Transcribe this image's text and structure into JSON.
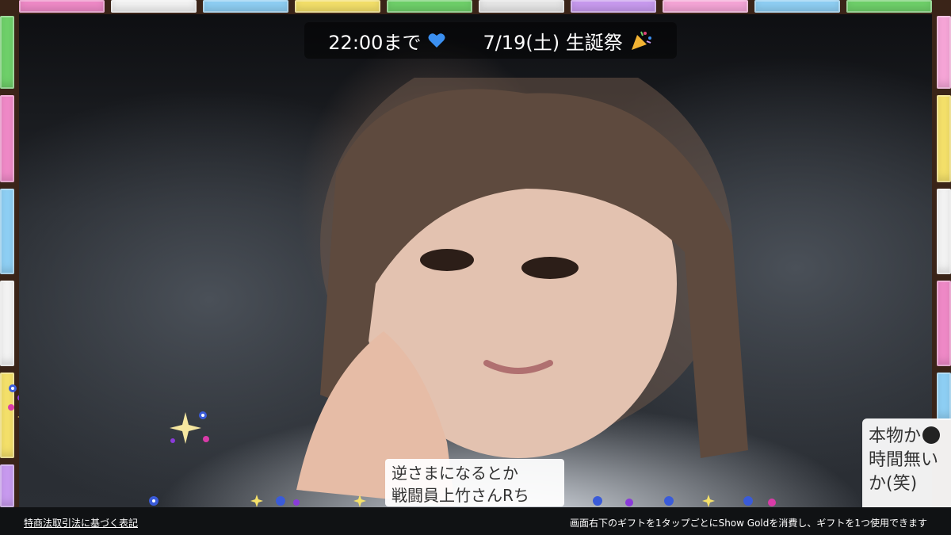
{
  "banner": {
    "time_text": "22:00まで",
    "date_text": "7/19(土) 生誕祭"
  },
  "chat_bubble": {
    "line1": "逆さまになるとか",
    "line2": "戦闘員上竹さんRち"
  },
  "side_comment": {
    "line1": "本物か",
    "line2": "時間無い",
    "line3": "か(笑)"
  },
  "footer": {
    "legal_link": "特商法取引法に基づく表記",
    "gift_notice": "画面右下のギフトを1タップごとにShow Goldを消費し、ギフトを1つ使用できます"
  },
  "colors": {
    "frame": "#3a2418",
    "tile_palette": [
      "#f08ac8",
      "#ffffff",
      "#8fd0f5",
      "#f5e16a",
      "#6fd16a",
      "#e8e8e8",
      "#c99bf0",
      "#f7a6d8"
    ]
  },
  "icons": [
    "blue-heart-icon",
    "party-popper-icon",
    "sparkle-icon"
  ]
}
